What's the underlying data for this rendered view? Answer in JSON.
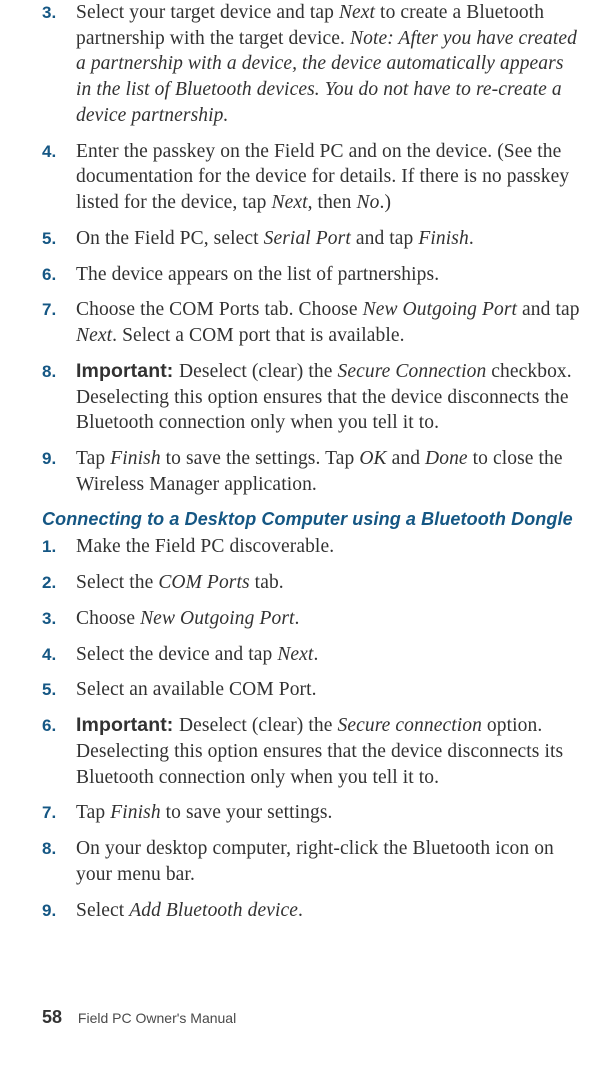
{
  "sectionA": {
    "items": [
      {
        "num": "3.",
        "parts": [
          {
            "t": "Select your target device and tap "
          },
          {
            "t": "Next",
            "i": true
          },
          {
            "t": " to create a Bluetooth partnership with the target device. "
          },
          {
            "t": "Note: After you have created a partnership with a device, the device automatically appears in the list of Bluetooth devices. You do not have to re-create a device partnership.",
            "i": true
          }
        ]
      },
      {
        "num": "4.",
        "parts": [
          {
            "t": "Enter the passkey on the Field PC and on the device. (See the documentation for the device for details. If there is no passkey listed for the device, tap "
          },
          {
            "t": "Next",
            "i": true
          },
          {
            "t": ", then "
          },
          {
            "t": "No",
            "i": true
          },
          {
            "t": ".)"
          }
        ]
      },
      {
        "num": "5.",
        "parts": [
          {
            "t": "On the Field PC, select "
          },
          {
            "t": "Serial Port",
            "i": true
          },
          {
            "t": " and tap "
          },
          {
            "t": "Finish",
            "i": true
          },
          {
            "t": "."
          }
        ]
      },
      {
        "num": "6.",
        "parts": [
          {
            "t": "The device appears on the list of partnerships."
          }
        ]
      },
      {
        "num": "7.",
        "parts": [
          {
            "t": "Choose the COM Ports tab. Choose "
          },
          {
            "t": "New Outgoing Port",
            "i": true
          },
          {
            "t": " and tap "
          },
          {
            "t": "Next",
            "i": true
          },
          {
            "t": ". Select a COM port that is available."
          }
        ]
      },
      {
        "num": "8.",
        "parts": [
          {
            "t": "Important: ",
            "bs": true
          },
          {
            "t": " Deselect (clear) the "
          },
          {
            "t": "Secure Connection",
            "i": true
          },
          {
            "t": " checkbox. Deselecting this option ensures that the device disconnects the Bluetooth connection only when you tell it to."
          }
        ]
      },
      {
        "num": "9.",
        "parts": [
          {
            "t": "Tap "
          },
          {
            "t": "Finish",
            "i": true
          },
          {
            "t": " to save the settings. Tap "
          },
          {
            "t": "OK",
            "i": true
          },
          {
            "t": " and "
          },
          {
            "t": "Done",
            "i": true
          },
          {
            "t": " to close the Wireless Manager application."
          }
        ]
      }
    ]
  },
  "heading": "Connecting to a Desktop Computer using a Bluetooth Dongle",
  "sectionB": {
    "items": [
      {
        "num": "1.",
        "parts": [
          {
            "t": "Make the Field PC discoverable."
          }
        ]
      },
      {
        "num": "2.",
        "parts": [
          {
            "t": "Select the "
          },
          {
            "t": "COM Ports",
            "i": true
          },
          {
            "t": " tab."
          }
        ]
      },
      {
        "num": "3.",
        "parts": [
          {
            "t": "Choose "
          },
          {
            "t": "New Outgoing Port",
            "i": true
          },
          {
            "t": "."
          }
        ]
      },
      {
        "num": "4.",
        "parts": [
          {
            "t": "Select the device and tap "
          },
          {
            "t": "Next",
            "i": true
          },
          {
            "t": "."
          }
        ]
      },
      {
        "num": "5.",
        "parts": [
          {
            "t": "Select an available COM Port."
          }
        ]
      },
      {
        "num": "6.",
        "parts": [
          {
            "t": "Important: ",
            "bs": true
          },
          {
            "t": " Deselect (clear) the "
          },
          {
            "t": "Secure connection",
            "i": true
          },
          {
            "t": " option. Deselecting this option ensures that the device disconnects its Bluetooth connection only when you tell it to."
          }
        ]
      },
      {
        "num": "7.",
        "parts": [
          {
            "t": "Tap "
          },
          {
            "t": "Finish",
            "i": true
          },
          {
            "t": " to save your settings."
          }
        ]
      },
      {
        "num": "8.",
        "parts": [
          {
            "t": "On your desktop computer, right-click the Bluetooth icon on your menu bar."
          }
        ]
      },
      {
        "num": "9.",
        "parts": [
          {
            "t": "Select "
          },
          {
            "t": "Add Bluetooth device",
            "i": true
          },
          {
            "t": "."
          }
        ]
      }
    ]
  },
  "footer": {
    "page": "58",
    "title": "Field PC Owner's Manual"
  }
}
